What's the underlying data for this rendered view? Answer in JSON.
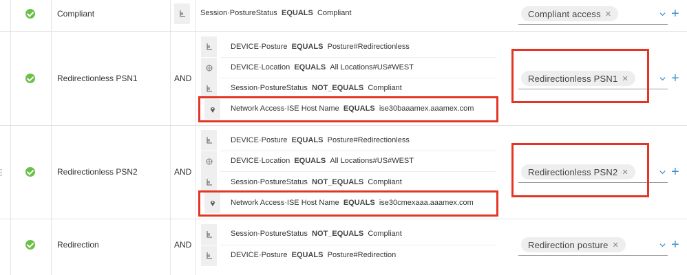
{
  "rows": [
    {
      "name": "Compliant",
      "operator": "",
      "conditions": [
        {
          "icon": "posture-icon",
          "attribute": "Session·PostureStatus",
          "operator": "EQUALS",
          "value": "Compliant"
        }
      ],
      "result": "Compliant access"
    },
    {
      "name": "Redirectionless PSN1",
      "operator": "AND",
      "conditions": [
        {
          "icon": "posture-icon",
          "attribute": "DEVICE·Posture",
          "operator": "EQUALS",
          "value": "Posture#Redirectionless"
        },
        {
          "icon": "globe-icon",
          "attribute": "DEVICE·Location",
          "operator": "EQUALS",
          "value": "All Locations#US#WEST"
        },
        {
          "icon": "posture-icon",
          "attribute": "Session·PostureStatus",
          "operator": "NOT_EQUALS",
          "value": "Compliant"
        },
        {
          "icon": "location-pin-icon",
          "attribute": "Network Access·ISE Host Name",
          "operator": "EQUALS",
          "value": "ise30baaamex.aaamex.com"
        }
      ],
      "result": "Redirectionless PSN1"
    },
    {
      "name": "Redirectionless PSN2",
      "operator": "AND",
      "conditions": [
        {
          "icon": "posture-icon",
          "attribute": "DEVICE·Posture",
          "operator": "EQUALS",
          "value": "Posture#Redirectionless"
        },
        {
          "icon": "globe-icon",
          "attribute": "DEVICE·Location",
          "operator": "EQUALS",
          "value": "All Locations#US#WEST"
        },
        {
          "icon": "posture-icon",
          "attribute": "Session·PostureStatus",
          "operator": "NOT_EQUALS",
          "value": "Compliant"
        },
        {
          "icon": "location-pin-icon",
          "attribute": "Network Access·ISE Host Name",
          "operator": "EQUALS",
          "value": "ise30cmexaaa.aaamex.com"
        }
      ],
      "result": "Redirectionless PSN2"
    },
    {
      "name": "Redirection",
      "operator": "AND",
      "conditions": [
        {
          "icon": "posture-icon",
          "attribute": "Session·PostureStatus",
          "operator": "NOT_EQUALS",
          "value": "Compliant"
        },
        {
          "icon": "posture-icon",
          "attribute": "DEVICE·Posture",
          "operator": "EQUALS",
          "value": "Posture#Redirection"
        }
      ],
      "result": "Redirection posture"
    }
  ],
  "colors": {
    "status_green": "#6cc04a",
    "highlight_red": "#e53423",
    "add_blue": "#3b91cf"
  }
}
